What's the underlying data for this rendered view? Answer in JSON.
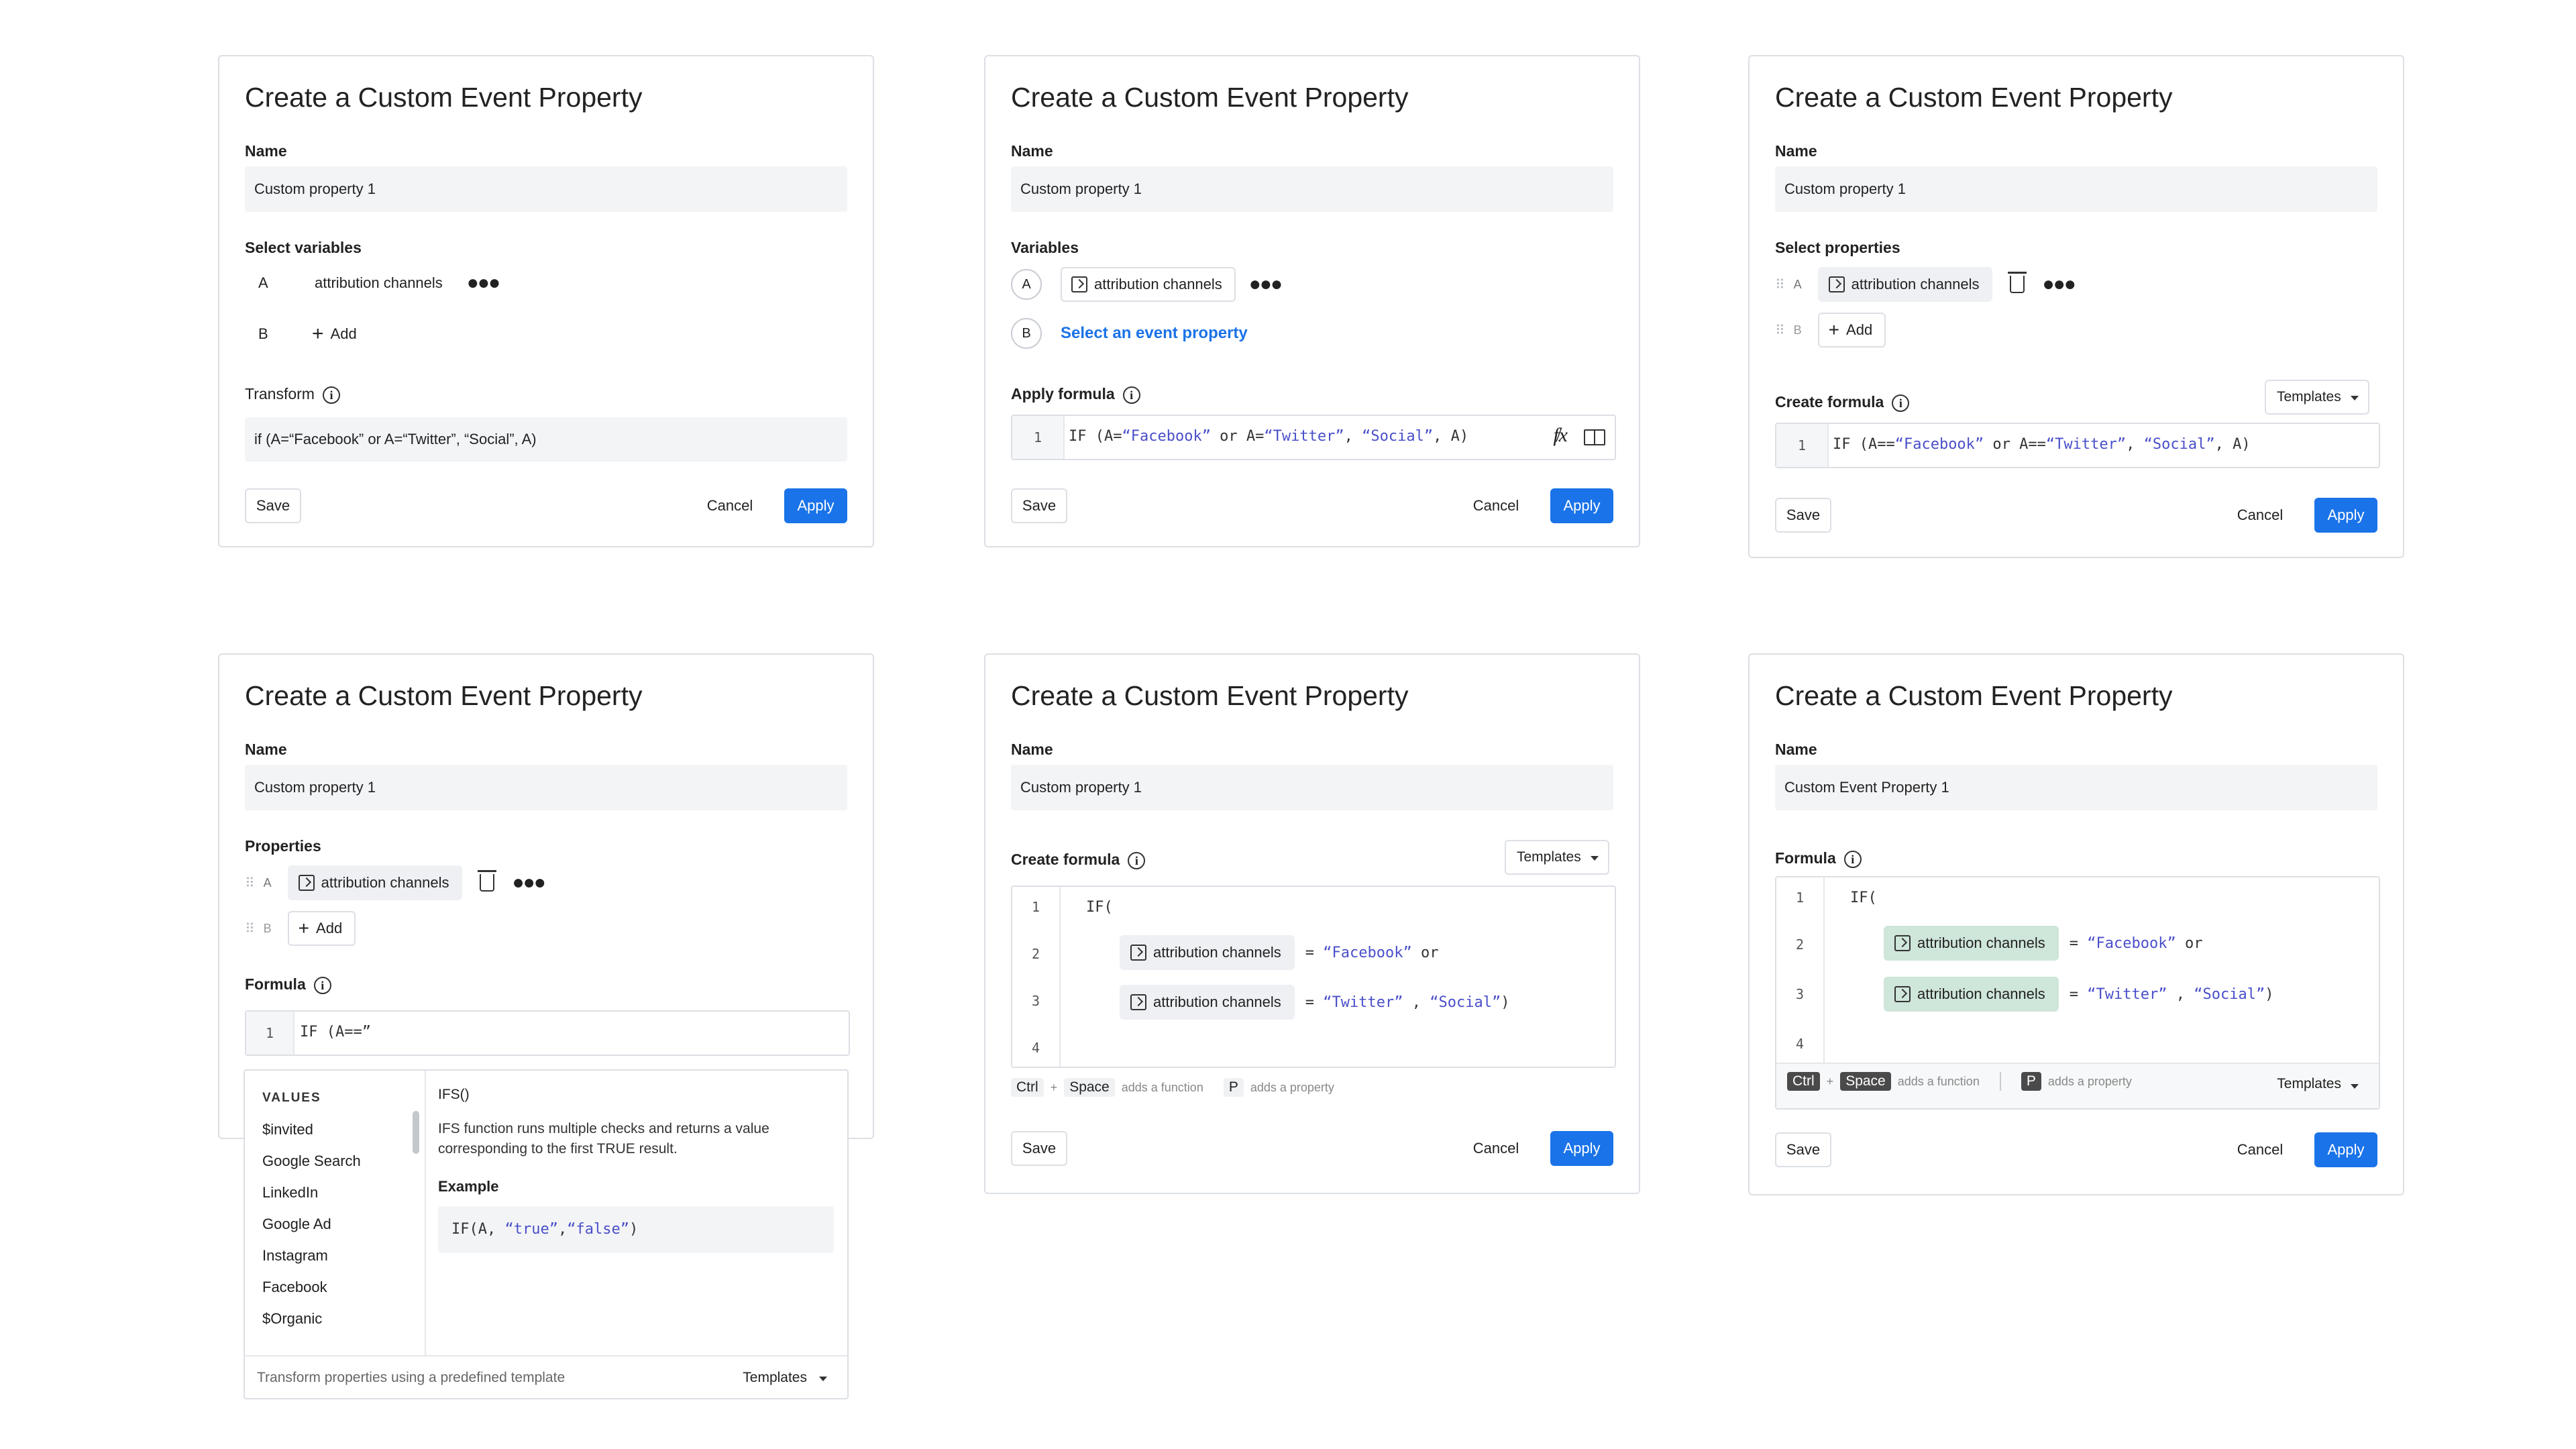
{
  "panels": [
    {
      "title": "Create a Custom Event Property",
      "name_label": "Name",
      "name_value": "Custom property 1",
      "vars_label": "Select variables",
      "var_a_letter": "A",
      "var_a_value": "attribution channels",
      "var_b_letter": "B",
      "var_b_value": "Add",
      "formula_label": "Transform",
      "formula_text": "if (A=“Facebook” or A=“Twitter”, “Social”, A)",
      "save": "Save",
      "cancel": "Cancel",
      "apply": "Apply"
    },
    {
      "title": "Create a Custom Event Property",
      "name_label": "Name",
      "name_value": "Custom property 1",
      "vars_label": "Variables",
      "var_a_letter": "A",
      "var_a_value": "attribution channels",
      "var_b_letter": "B",
      "var_b_value": "Select an event property",
      "formula_label": "Apply formula",
      "line1": "1",
      "save": "Save",
      "cancel": "Cancel",
      "apply": "Apply"
    },
    {
      "title": "Create a Custom Event Property",
      "name_label": "Name",
      "name_value": "Custom property 1",
      "vars_label": "Select properties",
      "var_a_letter": "A",
      "var_a_value": "attribution channels",
      "var_b_letter": "B",
      "var_b_value": "Add",
      "formula_label": "Create formula",
      "templates": "Templates",
      "line1": "1",
      "save": "Save",
      "cancel": "Cancel",
      "apply": "Apply"
    },
    {
      "title": "Create a Custom Event Property",
      "name_label": "Name",
      "name_value": "Custom property 1",
      "vars_label": "Properties",
      "var_a_letter": "A",
      "var_a_value": "attribution channels",
      "var_b_letter": "B",
      "var_b_value": "Add",
      "formula_label": "Formula",
      "line1": "1",
      "code_line": "IF (A==”",
      "dropdown": {
        "values_header": "VALUES",
        "values": [
          "$invited",
          "Google Search",
          "LinkedIn",
          "Google Ad",
          "Instagram",
          "Facebook",
          "$Organic"
        ],
        "fn_title": "IFS()",
        "fn_desc": "IFS function runs multiple checks and returns a value corresponding to the first TRUE result.",
        "example_label": "Example",
        "footer_hint": "Transform properties using a predefined template",
        "templates": "Templates"
      }
    },
    {
      "title": "Create a Custom Event Property",
      "name_label": "Name",
      "name_value": "Custom property 1",
      "formula_label": "Create formula",
      "templates": "Templates",
      "lines": [
        "1",
        "2",
        "3",
        "4"
      ],
      "chip": "attribution channels",
      "key_ctrl": "Ctrl",
      "key_space": "Space",
      "hint_fn": "adds a function",
      "key_p": "P",
      "hint_prop": "adds a property",
      "save": "Save",
      "cancel": "Cancel",
      "apply": "Apply"
    },
    {
      "title": "Create a Custom Event Property",
      "name_label": "Name",
      "name_value": "Custom Event Property 1",
      "formula_label": "Formula",
      "templates": "Templates",
      "lines": [
        "1",
        "2",
        "3",
        "4"
      ],
      "chip": "attribution channels",
      "key_ctrl": "Ctrl",
      "key_space": "Space",
      "hint_fn": "adds a function",
      "key_p": "P",
      "hint_prop": "adds a property",
      "save": "Save",
      "cancel": "Cancel",
      "apply": "Apply"
    }
  ],
  "colors": {
    "apply": "#1a73e8",
    "link": "#1a73e8",
    "chip_green": "#cfe6da",
    "string": "#4a4fc9"
  }
}
